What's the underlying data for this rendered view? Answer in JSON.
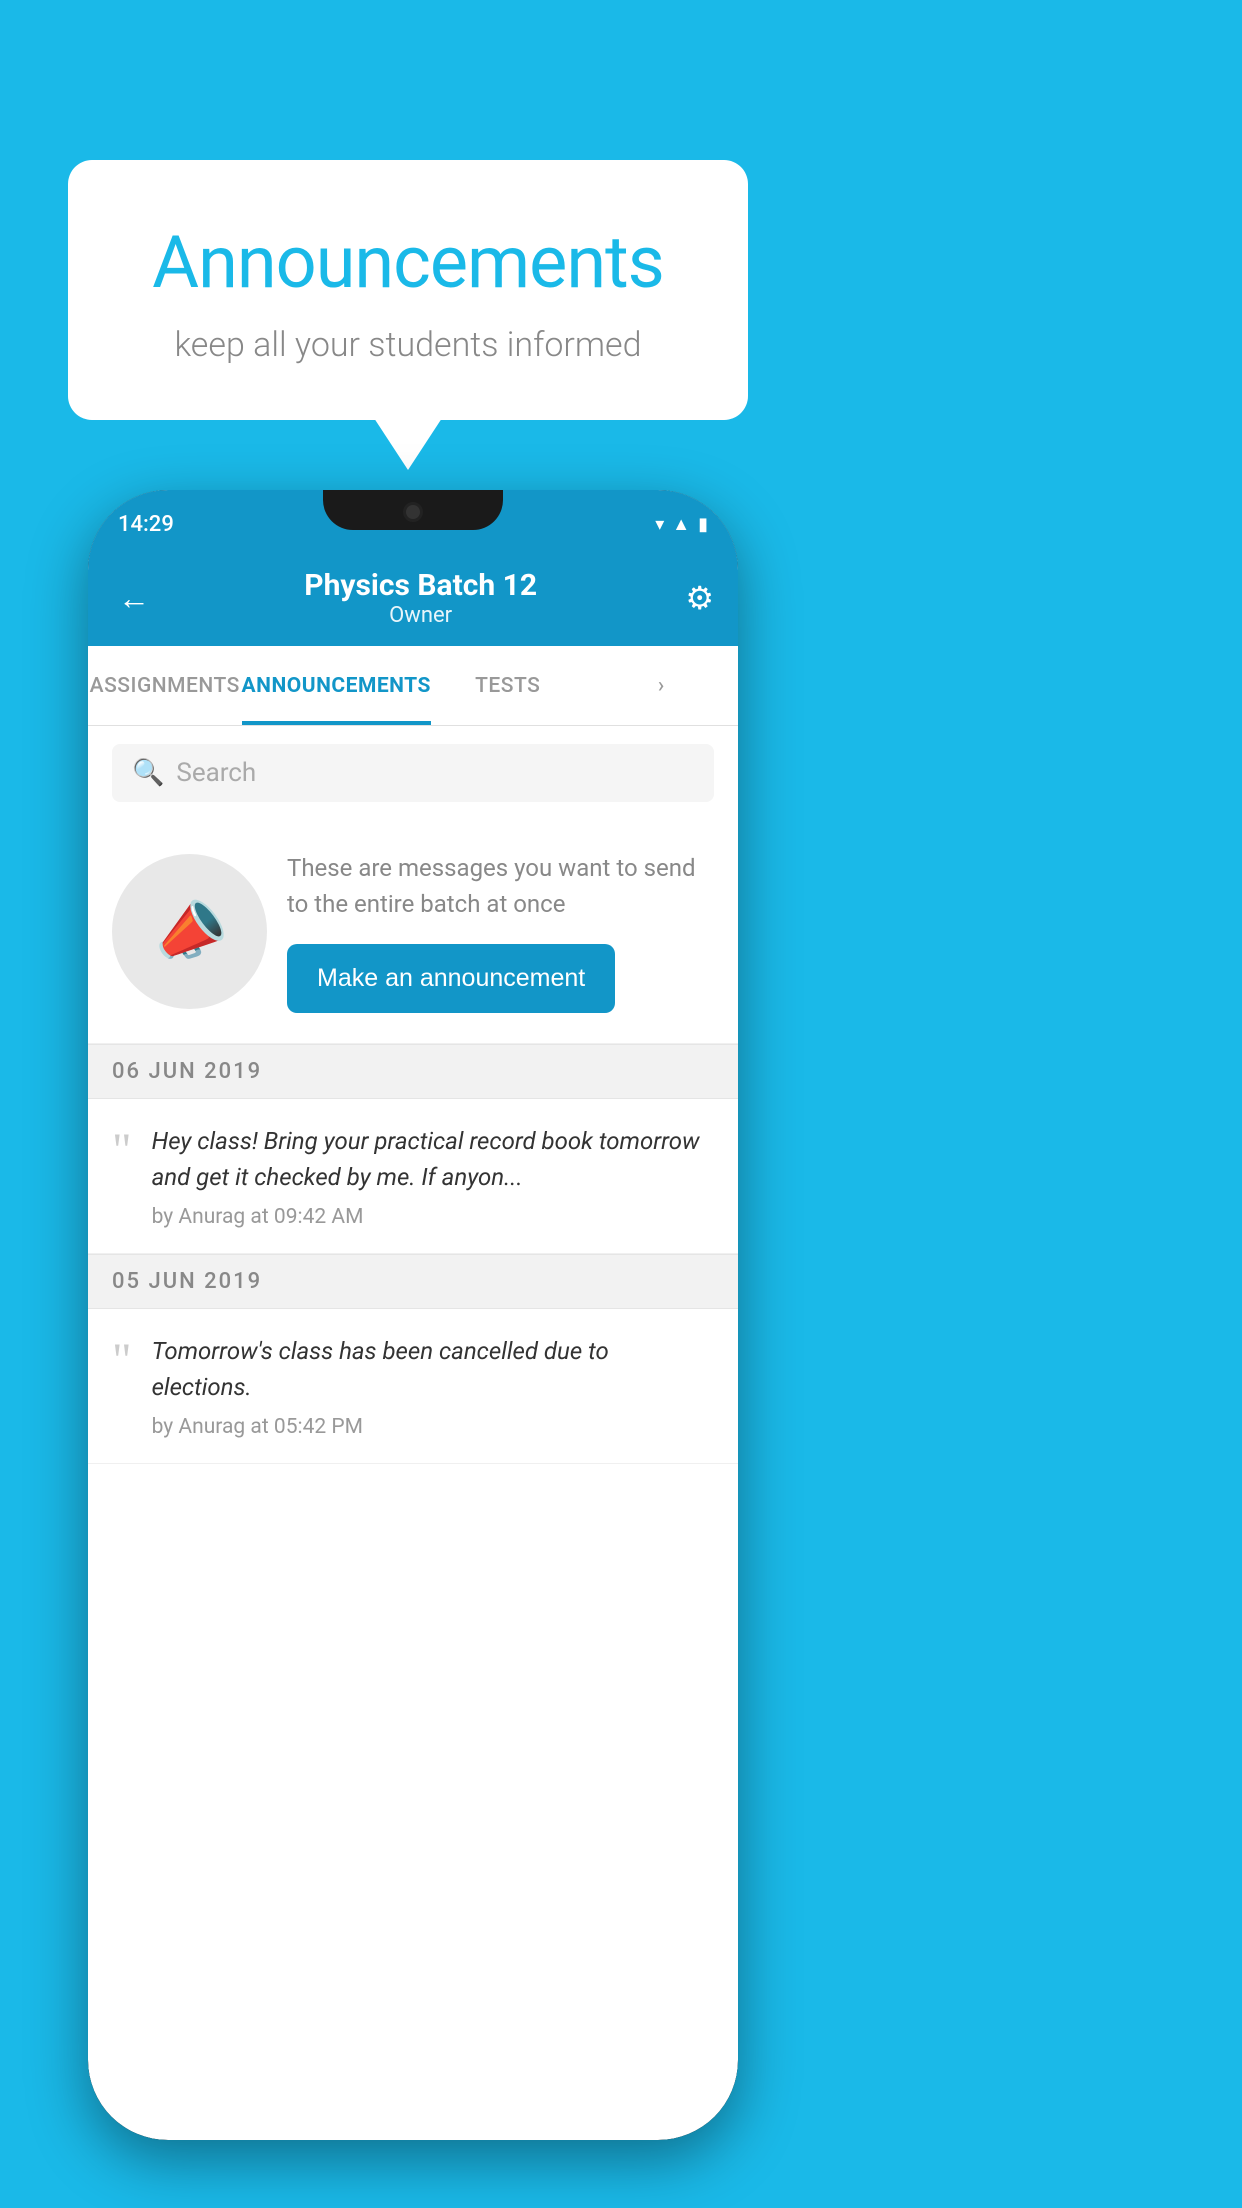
{
  "background": {
    "color": "#1ab9e8"
  },
  "speech_bubble": {
    "title": "Announcements",
    "subtitle": "keep all your students informed"
  },
  "phone": {
    "status_bar": {
      "time": "14:29"
    },
    "header": {
      "title": "Physics Batch 12",
      "subtitle": "Owner",
      "back_label": "←",
      "gear_label": "⚙"
    },
    "tabs": [
      {
        "label": "ASSIGNMENTS",
        "active": false
      },
      {
        "label": "ANNOUNCEMENTS",
        "active": true
      },
      {
        "label": "TESTS",
        "active": false
      },
      {
        "label": "...",
        "active": false
      }
    ],
    "search": {
      "placeholder": "Search"
    },
    "promo": {
      "description": "These are messages you want to send to the entire batch at once",
      "button_label": "Make an announcement"
    },
    "announcements": [
      {
        "date": "06  JUN  2019",
        "message": "Hey class! Bring your practical record book tomorrow and get it checked by me. If anyon...",
        "meta": "by Anurag at 09:42 AM"
      },
      {
        "date": "05  JUN  2019",
        "message": "Tomorrow's class has been cancelled due to elections.",
        "meta": "by Anurag at 05:42 PM"
      }
    ]
  }
}
